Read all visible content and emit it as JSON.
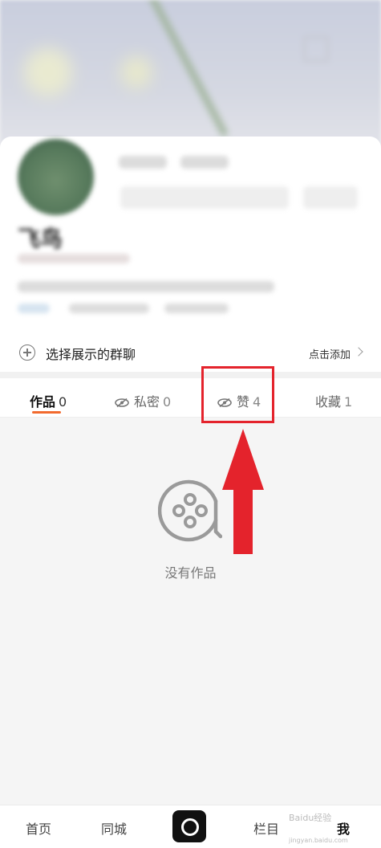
{
  "profile": {
    "name": "飞鸟"
  },
  "group_row": {
    "label": "选择展示的群聊",
    "add_link": "点击添加"
  },
  "tabs": [
    {
      "label": "作品",
      "count": "0",
      "icon": "",
      "active": true
    },
    {
      "label": "私密",
      "count": "0",
      "icon": "eye-slash-icon",
      "active": false
    },
    {
      "label": "赞",
      "count": "4",
      "icon": "eye-slash-icon",
      "active": false
    },
    {
      "label": "收藏",
      "count": "1",
      "icon": "",
      "active": false
    }
  ],
  "empty_state": {
    "text": "没有作品",
    "icon": "film-reel-icon"
  },
  "bottom_nav": {
    "items": [
      "首页",
      "同城",
      "栏目",
      "我"
    ],
    "camera_icon": "camera-record-icon"
  },
  "annotation": {
    "box_color": "#e4232c",
    "arrow_color": "#e4232c"
  },
  "watermark": {
    "line1": "Baidu经验",
    "line2": "jingyan.baidu.com"
  },
  "colors": {
    "accent_underline": "#f26a2e"
  }
}
